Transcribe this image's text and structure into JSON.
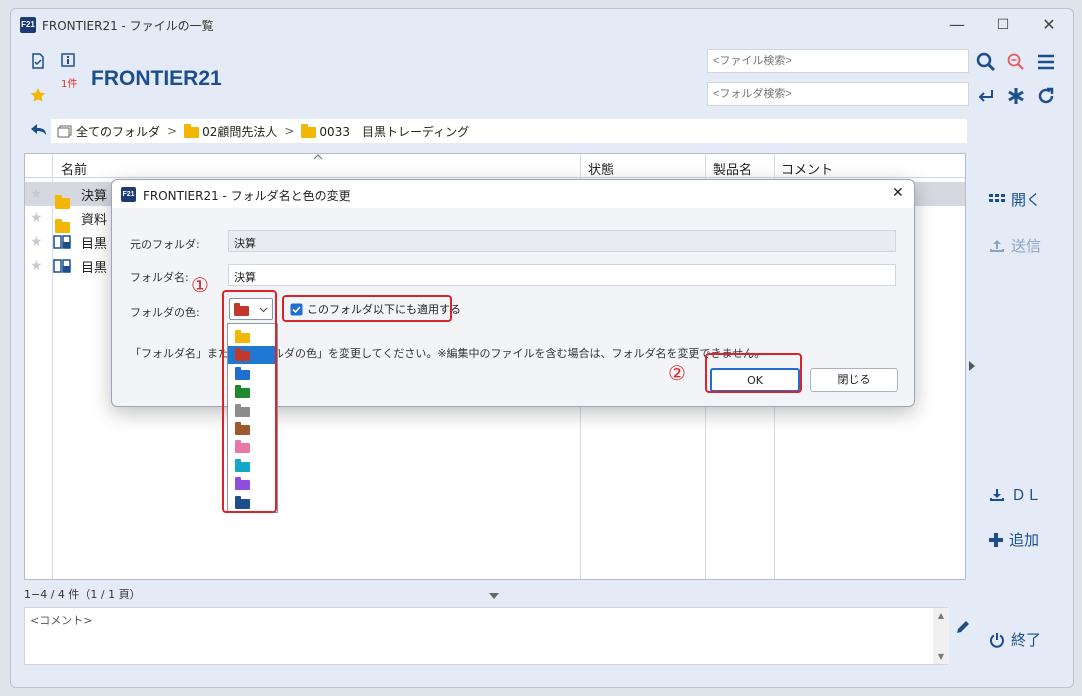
{
  "window": {
    "badge": "F21",
    "title": "FRONTIER21 - ファイルの一覧",
    "minimize": "—",
    "maximize": "☐",
    "close": "✕"
  },
  "header": {
    "count": "1件",
    "brand": "FRONTIER21",
    "file_search_placeholder": "<ファイル検索>",
    "folder_search_placeholder": "<フォルダ検索>"
  },
  "breadcrumb": {
    "root": "全てのフォルダ",
    "items": [
      "02顧問先法人",
      "0033　目黒トレーディング"
    ],
    "folder_color": "#f2b705"
  },
  "list": {
    "columns": {
      "name": "名前",
      "status": "状態",
      "product": "製品名",
      "comment": "コメント"
    },
    "rows": [
      {
        "name": "決算",
        "type": "folder"
      },
      {
        "name": "資料",
        "type": "folder"
      },
      {
        "name": "目黒",
        "type": "book"
      },
      {
        "name": "目黒",
        "type": "book"
      }
    ]
  },
  "status_bar": {
    "text": "1−4 / 4 件（1 / 1 頁）"
  },
  "comment_box": {
    "placeholder": "<コメント>"
  },
  "sidebar": {
    "open": "開く",
    "send": "送信",
    "download": "ＤＬ",
    "add": "追加",
    "exit": "終了"
  },
  "dialog": {
    "badge": "F21",
    "title": "FRONTIER21 - フォルダ名と色の変更",
    "original_label": "元のフォルダ:",
    "original_value": "決算",
    "name_label": "フォルダ名:",
    "name_value": "決算",
    "color_label": "フォルダの色:",
    "apply_sub": "このフォルダ以下にも適用する",
    "apply_checked": true,
    "note": "「フォルダ名」または「フォルダの色」を変更してください。※編集中のファイルを含む場合は、フォルダ名を変更できません。",
    "ok": "OK",
    "close": "閉じる",
    "selected_color": "#c0392b",
    "color_options": [
      "#f2b705",
      "#c0392b",
      "#1f6fd1",
      "#1e8a2e",
      "#8c8c8c",
      "#9c5a2e",
      "#e879a6",
      "#12a7c9",
      "#8e4ee0",
      "#1c4e8c"
    ],
    "highlighted_option": 1
  },
  "annotations": {
    "one": "①",
    "two": "②"
  }
}
